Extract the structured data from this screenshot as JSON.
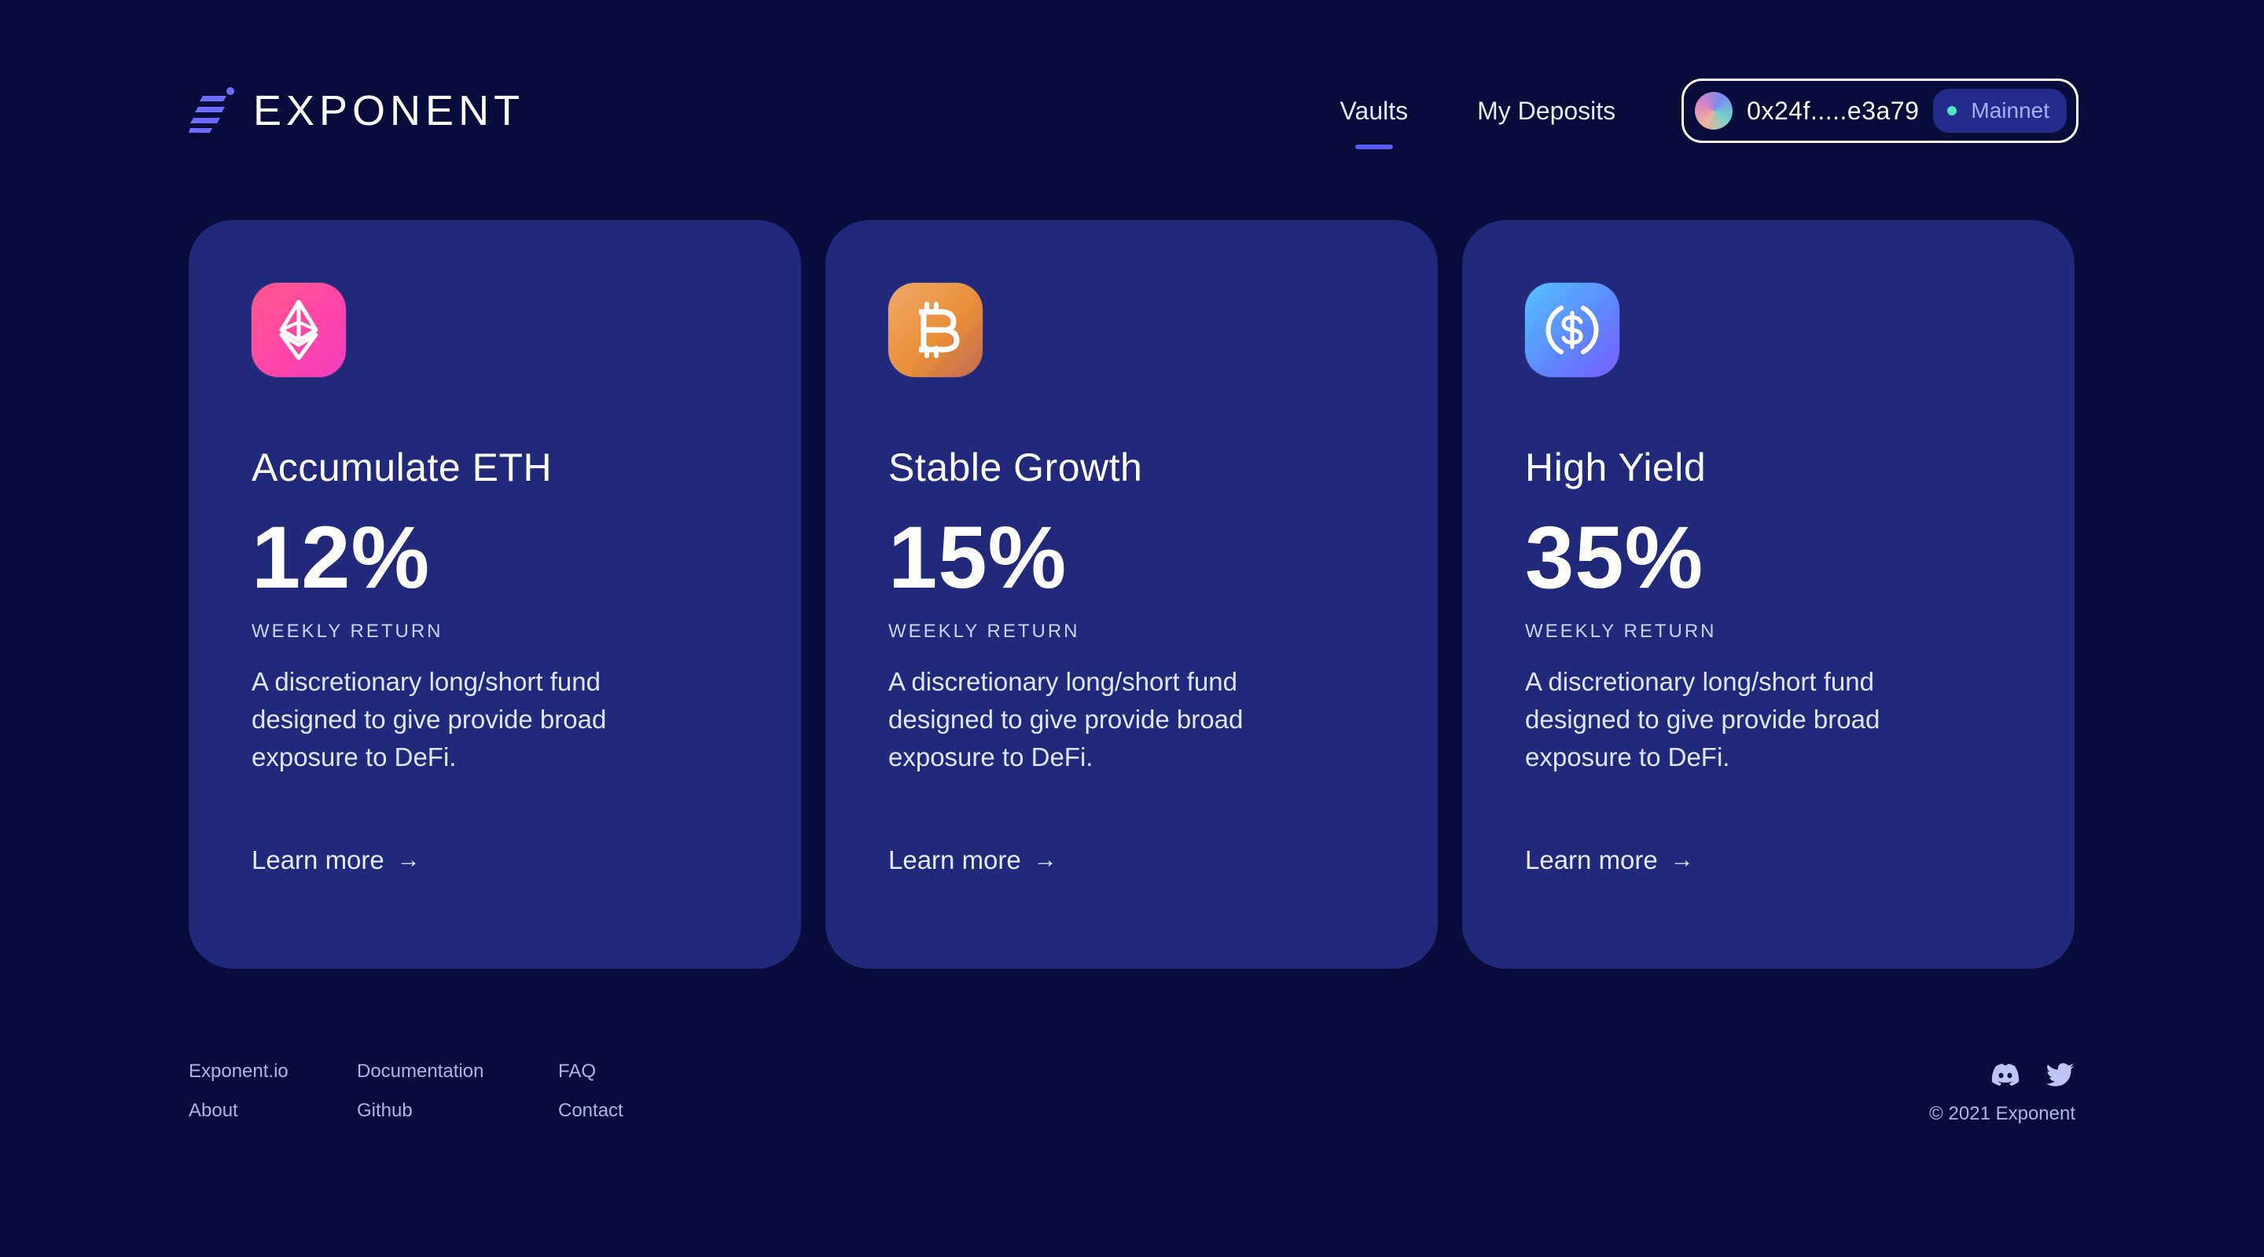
{
  "brand": {
    "name": "EXPONENT",
    "accent_color": "#5a5cf0",
    "icon": "exponent-logo-icon"
  },
  "nav": {
    "items": [
      {
        "label": "Vaults",
        "active": true
      },
      {
        "label": "My Deposits",
        "active": false
      }
    ]
  },
  "wallet": {
    "address": "0x24f.....e3a79",
    "network": "Mainnet",
    "network_status_color": "#4fe3c4"
  },
  "cards": [
    {
      "icon": "ethereum-icon",
      "title": "Accumulate ETH",
      "rate": "12%",
      "rate_label": "WEEKLY RETURN",
      "description": "A discretionary long/short fund designed to give provide broad exposure to DeFi.",
      "link_label": "Learn more",
      "link_arrow": "→"
    },
    {
      "icon": "bitcoin-icon",
      "title": "Stable Growth",
      "rate": "15%",
      "rate_label": "WEEKLY RETURN",
      "description": "A discretionary long/short fund designed to give provide broad exposure to DeFi.",
      "link_label": "Learn more",
      "link_arrow": "→"
    },
    {
      "icon": "usdc-icon",
      "title": "High Yield",
      "rate": "35%",
      "rate_label": "WEEKLY RETURN",
      "description": "A discretionary long/short fund designed to give provide broad exposure to DeFi.",
      "link_label": "Learn more",
      "link_arrow": "→"
    }
  ],
  "footer": {
    "links": [
      "Exponent.io",
      "Documentation",
      "FAQ",
      "About",
      "Github",
      "Contact"
    ],
    "socials": [
      "discord-icon",
      "twitter-icon"
    ],
    "copyright": "© 2021 Exponent"
  },
  "colors": {
    "background": "#090b3b",
    "card": "#22287a"
  }
}
